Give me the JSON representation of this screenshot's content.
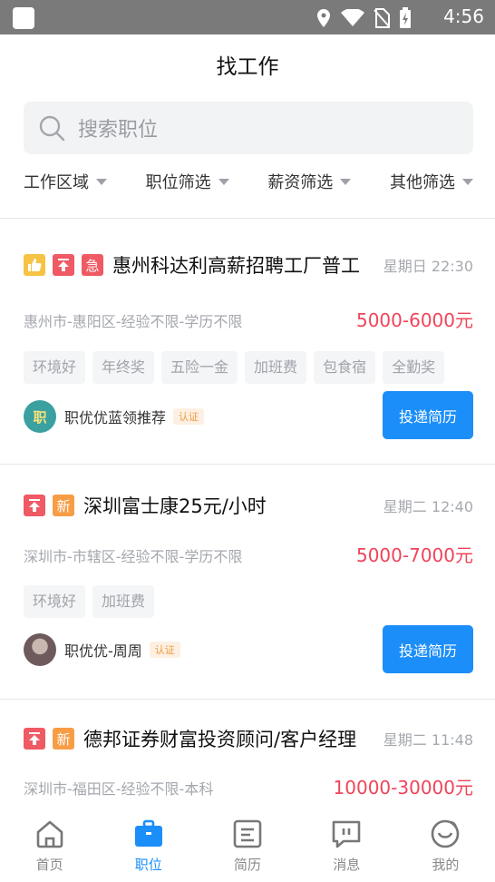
{
  "status": {
    "time": "4:56"
  },
  "page_title": "找工作",
  "search": {
    "placeholder": "搜索职位"
  },
  "filters": [
    {
      "label": "工作区域"
    },
    {
      "label": "职位筛选"
    },
    {
      "label": "薪资筛选"
    },
    {
      "label": "其他筛选"
    }
  ],
  "jobs": [
    {
      "badges": [
        "hot",
        "top",
        "急"
      ],
      "title": "惠州科达利高薪招聘工厂普工",
      "time": "星期日 22:30",
      "location": "惠州市-惠阳区-经验不限-学历不限",
      "salary": "5000-6000元",
      "tags": [
        "环境好",
        "年终奖",
        "五险一金",
        "加班费",
        "包食宿",
        "全勤奖"
      ],
      "recruiter": "职优优蓝领推荐",
      "verified": "认证",
      "apply_label": "投递简历"
    },
    {
      "badges": [
        "top",
        "新"
      ],
      "title": "深圳富士康25元/小时",
      "time": "星期二 12:40",
      "location": "深圳市-市辖区-经验不限-学历不限",
      "salary": "5000-7000元",
      "tags": [
        "环境好",
        "加班费"
      ],
      "recruiter": "职优优-周周",
      "verified": "认证",
      "apply_label": "投递简历"
    },
    {
      "badges": [
        "top",
        "新"
      ],
      "title": "德邦证券财富投资顾问/客户经理",
      "time": "星期二 11:48",
      "location": "深圳市-福田区-经验不限-本科",
      "salary": "10000-30000元"
    }
  ],
  "tabs": [
    {
      "label": "首页",
      "icon": "home-icon"
    },
    {
      "label": "职位",
      "icon": "briefcase-icon"
    },
    {
      "label": "简历",
      "icon": "resume-icon"
    },
    {
      "label": "消息",
      "icon": "message-icon"
    },
    {
      "label": "我的",
      "icon": "profile-icon"
    }
  ],
  "colors": {
    "accent": "#1c8ef9",
    "salary": "#f0445a",
    "statusbar": "#7a7a7a"
  }
}
